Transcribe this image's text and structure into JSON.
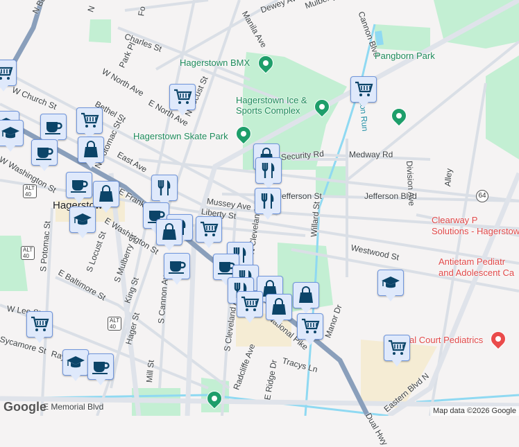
{
  "streets": [
    "N Burhans Blvd",
    "Charles St",
    "Park Pl",
    "W North Ave",
    "E North Ave",
    "N Locust St",
    "W Church St",
    "Bethel St",
    "N Potomac St",
    "East Ave",
    "E Franklin St",
    "W Washington St",
    "E Washington St",
    "S Potomac St",
    "S Locust St",
    "S Mulberry St",
    "E Baltimore St",
    "W Lee St",
    "Sycamore St",
    "King St",
    "Hager St",
    "S Cannon Ave",
    "Mill St",
    "S Cleveland Ave",
    "Radcliffe Ave",
    "E Ridge Dr",
    "Tracys Ln",
    "Manor Dr",
    "E Memorial Blvd",
    "Mussey Ave",
    "Liberty St",
    "N Cleveland Ave",
    "Jefferson St",
    "Jefferson Blvd",
    "Security Rd",
    "Medway Rd",
    "Division Ave",
    "Alley",
    "Willard St",
    "Westwood St",
    "Eastern Blvd N",
    "Dual Hwy",
    "Manila Ave",
    "Dewey Ave",
    "Mulberry",
    "Cannon Blvd",
    "Hamilton Run",
    "Fo",
    "N",
    "Ray",
    "National Pike"
  ],
  "places": {
    "bmx": "Hagerstown BMX",
    "ice": "Hagerstown Ice & Sports Complex",
    "skate": "Hagerstown Skate Park",
    "pangborn": "Pangborn Park",
    "clearway": "Clearway Pain Solutions - Hagerstown",
    "antietam": "Antietam Pediatric and Adolescent Care",
    "pediatrics": "Medical Court Pediatrics",
    "city": "Hagerstown"
  },
  "places_visible": {
    "clearway": "Clearway P\nSolutions - Hagerstow",
    "antietam": "Antietam Pediatr\nand Adolescent Ca",
    "pediatrics": "al Court Pediatrics"
  },
  "shields": {
    "alt": "ALT",
    "us40": "40",
    "md64": "64"
  },
  "attribution": "Map data ©2026 Google",
  "logo": "Google",
  "colors": {
    "park": "#c3efd3",
    "water": "#8fd9f2",
    "highway": "#8a9fbb",
    "marker": "#dfe9fb",
    "icon": "#0b4468",
    "poi_green": "#1e9e6a",
    "medical": "#ea4b4b",
    "commercial": "#f5ecd4"
  }
}
